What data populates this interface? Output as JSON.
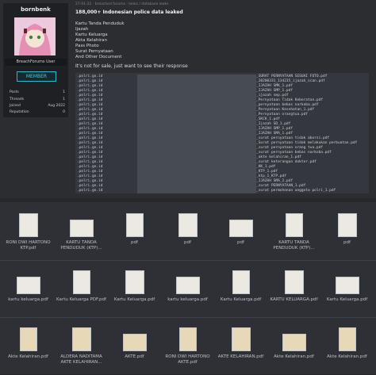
{
  "post": {
    "meta": "27-01-22 · breached forums · leaks / database leaks",
    "title": "188,000+ Indonesian police data leaked",
    "items": [
      "Kartu Tanda Penduduk",
      "Ijazah",
      "Kartu Keluarga",
      "Akta Kelahiran",
      "Pass Photo",
      "Surat Pernyataan",
      "And Other Document"
    ],
    "sale_note": "It's not for sale, just want to see their response"
  },
  "user": {
    "name": "bornbenk",
    "role": "BreachForums User",
    "rank": "MEMBER",
    "stats": [
      {
        "k": "Posts",
        "v": "1"
      },
      {
        "k": "Threads",
        "v": "1"
      },
      {
        "k": "Joined",
        "v": "Aug 2022"
      },
      {
        "k": "Reputation",
        "v": "0"
      }
    ]
  },
  "terminal": {
    "prefix": ".polri.go.id",
    "files": [
      "_SURAT PERNYATAAN SESUAI FOTO.pdf",
      "_20200331_134235_ijazah_scan.pdf",
      "_IJAZAH SMK_1.pdf",
      "_IJAZAH SMP_1.pdf",
      "_ijazah smp.pdf",
      "_Pernyataan Tidak Keberatan.pdf",
      "_pernyataan bebas narkoba.pdf",
      "_Pernyataan Kesehatan_1.pdf",
      "_Pernyataan orangtua.pdf",
      "_SKCK_1.pdf",
      "_Ijazah SD_1.pdf",
      "_IJAZAH SMP_1.pdf",
      "_IJAZAH SMA_1.pdf",
      "_surat pernyataan tidak aborsi.pdf",
      "_Surat pernyataan tidak melakukan perbuatan.pdf",
      "_surat pernyataan orang tua.pdf",
      "_surat pernyataan bebas narkoba.pdf",
      "_akte kelahiran_1.pdf",
      "_surat keterangan dokter.pdf",
      "_KK_1.pdf",
      "_KTP_1.pdf",
      "_ktp_1_KTP.pdf",
      "_IJAZAH SMA_2.pdf",
      "_surat PERNYATAAN_1.pdf",
      "_surat permohonan anggota polri_1.pdf"
    ]
  },
  "files": {
    "row1": [
      "RONI DWI HARTONO KTP.pdf",
      "KARTU TANDA PENDUDUK (KTP)...",
      "pdf",
      "pdf",
      "pdf",
      "KARTU TANDA PENDUDUK (KTP)...",
      "pdf"
    ],
    "row2": [
      "kartu keluarga.pdf",
      "Kartu Keluarga PDF.pdf",
      "Kartu Keluarga.pdf",
      "kartu keluarga.pdf",
      "Kartu Keluarga.pdf",
      "KARTU KELUARGA.pdf",
      "Kartu Keluarga.pdf"
    ],
    "row3": [
      "Akte Kelahiran.pdf",
      "ALDERA NADITAMA AKTE KELAHIRAN...",
      "AKTE.pdf",
      "RONI DWI HARTONO AKTE.pdf",
      "AKTE KELAHIRAN.pdf",
      "Akte Kelahiran.pdf",
      "Akte Kelahiran.pdf"
    ]
  }
}
